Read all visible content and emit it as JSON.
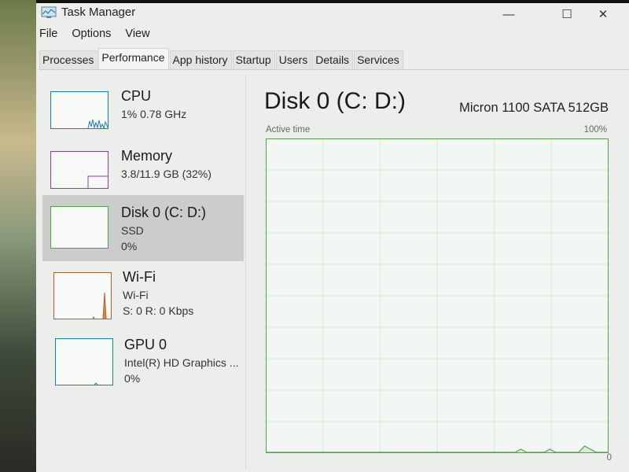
{
  "window": {
    "title": "Task Manager",
    "icon": "task-manager-icon",
    "controls": {
      "minimize": "—",
      "maximize": "☐",
      "close": "✕"
    }
  },
  "menu": [
    "File",
    "Options",
    "View"
  ],
  "tabs": [
    {
      "label": "Processes",
      "active": false
    },
    {
      "label": "Performance",
      "active": true
    },
    {
      "label": "App history",
      "active": false
    },
    {
      "label": "Startup",
      "active": false
    },
    {
      "label": "Users",
      "active": false
    },
    {
      "label": "Details",
      "active": false
    },
    {
      "label": "Services",
      "active": false
    }
  ],
  "sidebar": {
    "items": [
      {
        "title": "CPU",
        "sub1": "1% 0.78 GHz",
        "sub2": "",
        "color": "#1b7db0",
        "selected": false
      },
      {
        "title": "Memory",
        "sub1": "3.8/11.9 GB (32%)",
        "sub2": "",
        "color": "#8b3fa0",
        "selected": false
      },
      {
        "title": "Disk 0 (C: D:)",
        "sub1": "SSD",
        "sub2": "0%",
        "color": "#4da24a",
        "selected": true
      },
      {
        "title": "Wi-Fi",
        "sub1": "Wi-Fi",
        "sub2": "S: 0 R: 0 Kbps",
        "color": "#b5602a",
        "selected": false
      },
      {
        "title": "GPU 0",
        "sub1": "Intel(R) HD Graphics ...",
        "sub2": "0%",
        "color": "#1b7db0",
        "selected": false
      }
    ]
  },
  "main": {
    "title": "Disk 0 (C: D:)",
    "device": "Micron 1100 SATA 512GB",
    "chart_label": "Active time",
    "chart_max": "100%",
    "chart_min": "0"
  },
  "chart_data": {
    "type": "line",
    "title": "Active time",
    "ylabel": "Active time (%)",
    "ylim": [
      0,
      100
    ],
    "grid": true,
    "values": [
      0,
      0,
      0,
      0,
      0,
      0,
      0,
      0,
      0,
      0,
      0,
      0,
      0,
      0,
      0,
      0,
      0,
      0,
      0,
      0,
      0,
      0,
      0,
      0,
      0,
      0,
      0,
      0,
      0,
      0,
      0,
      0,
      0,
      0,
      0,
      0,
      0,
      0,
      0,
      0,
      0,
      0,
      0,
      0,
      1,
      0,
      0,
      0,
      0,
      1,
      0,
      0,
      0,
      0,
      0,
      2,
      1,
      0,
      0,
      0
    ]
  }
}
